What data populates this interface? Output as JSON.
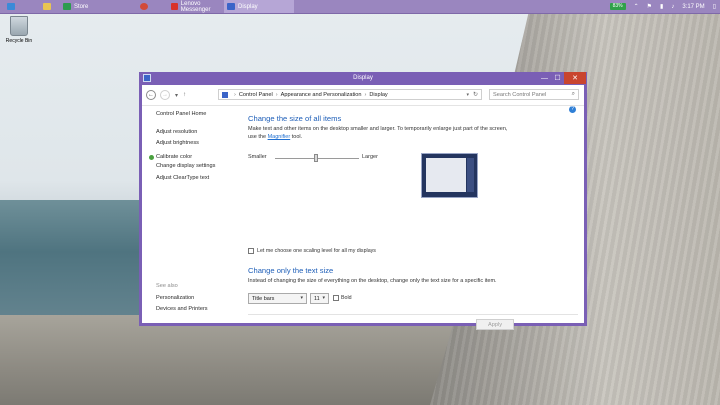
{
  "taskbar": {
    "items": [
      {
        "label": "",
        "icon": "ie-icon"
      },
      {
        "label": "",
        "icon": "folder-icon"
      },
      {
        "label": "Store",
        "icon": "store-icon"
      },
      {
        "label": "",
        "icon": "chrome-icon"
      },
      {
        "label": "Lenovo Messenger",
        "icon": "messenger-icon"
      },
      {
        "label": "Display",
        "icon": "display-icon"
      }
    ],
    "battery": "83%",
    "time": "3:17 PM"
  },
  "desktop": {
    "recycle_bin_label": "Recycle Bin"
  },
  "window": {
    "title": "Display",
    "minimize": "—",
    "maximize": "☐",
    "close": "✕"
  },
  "nav": {
    "breadcrumb": [
      "Control Panel",
      "Appearance and Personalization",
      "Display"
    ],
    "search_placeholder": "Search Control Panel"
  },
  "sidebar": {
    "home": "Control Panel Home",
    "items": [
      "Adjust resolution",
      "Adjust brightness",
      "Calibrate color",
      "Change display settings",
      "Adjust ClearType text"
    ],
    "see_also_label": "See also",
    "see_also": [
      "Personalization",
      "Devices and Printers"
    ]
  },
  "main": {
    "heading1": "Change the size of all items",
    "desc1_line1": "Make text and other items on the desktop smaller and larger. To temporarily enlarge just part of the screen,",
    "desc1_pre": "use the ",
    "magnifier_link": "Magnifier",
    "desc1_post": " tool.",
    "slider_small": "Smaller",
    "slider_large": "Larger",
    "scaling_checkbox": "Let me choose one scaling level for all my displays",
    "heading2": "Change only the text size",
    "desc2": "Instead of changing the size of everything on the desktop, change only the text size for a specific item.",
    "item_select": "Title bars",
    "size_select": "11",
    "bold_label": "Bold",
    "apply": "Apply"
  }
}
